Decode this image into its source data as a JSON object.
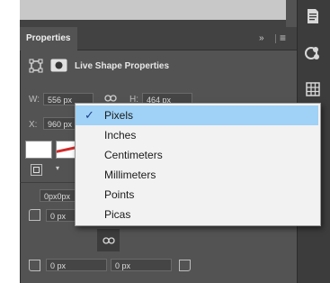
{
  "panel": {
    "tab_title": "Properties",
    "collapse_glyph": "»",
    "menu_glyph": "≡",
    "section_title": "Live Shape Properties"
  },
  "fields": {
    "w_label": "W:",
    "w_value": "556 px",
    "h_label": "H:",
    "h_value": "464 px",
    "x_label": "X:",
    "x_value": "960 px",
    "offset_value": "0px0px",
    "corner_tl": "0 px",
    "corner_tr": "0 px",
    "corner_bl": "0 px",
    "corner_br": "0 px"
  },
  "units_menu": {
    "selected": "Pixels",
    "items": [
      "Pixels",
      "Inches",
      "Centimeters",
      "Millimeters",
      "Points",
      "Picas"
    ]
  },
  "colors": {
    "panel_bg": "#535353",
    "menu_bg": "#f2f2f2",
    "menu_highlight": "#9fd2f6",
    "stroke_red": "#d12b2b"
  },
  "icons": [
    "transform-icon",
    "mask-icon",
    "link-icon",
    "paragraph-icon",
    "styles-icon",
    "grid-icon",
    "adjust-icon"
  ]
}
